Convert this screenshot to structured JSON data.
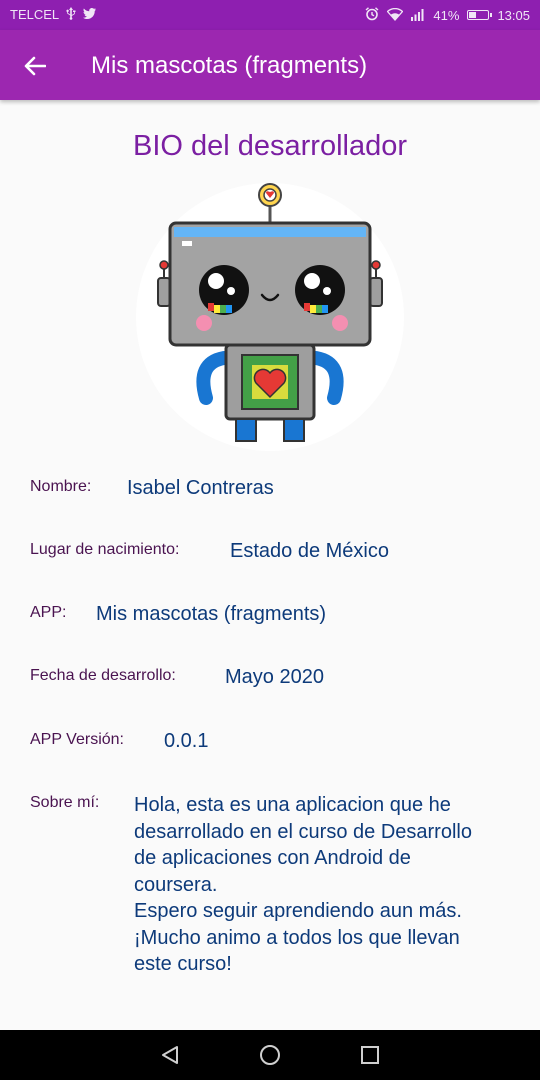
{
  "status_bar": {
    "carrier": "TELCEL",
    "battery_percent": "41%",
    "battery_level": 0.41,
    "time": "13:05",
    "icons": [
      "usb-icon",
      "twitter-icon",
      "alarm-icon",
      "wifi-icon",
      "signal-icon",
      "battery-icon"
    ]
  },
  "app_bar": {
    "title": "Mis mascotas (fragments)",
    "back_icon": "arrow-back-icon"
  },
  "page_title": "BIO del desarrollador",
  "fields": {
    "name": {
      "label": "Nombre:",
      "value": "Isabel Contreras"
    },
    "birthplace": {
      "label": "Lugar de nacimiento:",
      "value": "Estado de México"
    },
    "app": {
      "label": "APP:",
      "value": "Mis mascotas (fragments)"
    },
    "date": {
      "label": "Fecha de desarrollo:",
      "value": "Mayo 2020"
    },
    "version": {
      "label": "APP Versión:",
      "value": "0.0.1"
    },
    "about": {
      "label": "Sobre mí:",
      "value": "Hola, esta es una aplicacion que he\ndesarrollado en el curso de Desarrollo\nde aplicaciones con Android de\ncoursera.\n Espero seguir aprendiendo aun más.\n¡Mucho animo a todos los que llevan\neste curso!"
    }
  },
  "colors": {
    "status_bar": "#8e1fb0",
    "app_bar": "#9c27b0",
    "title": "#7b1fa2",
    "label": "#4a1350",
    "value": "#0d3a7a"
  },
  "nav_bar": {
    "icons": [
      "back-triangle-icon",
      "home-circle-icon",
      "recents-square-icon"
    ]
  }
}
